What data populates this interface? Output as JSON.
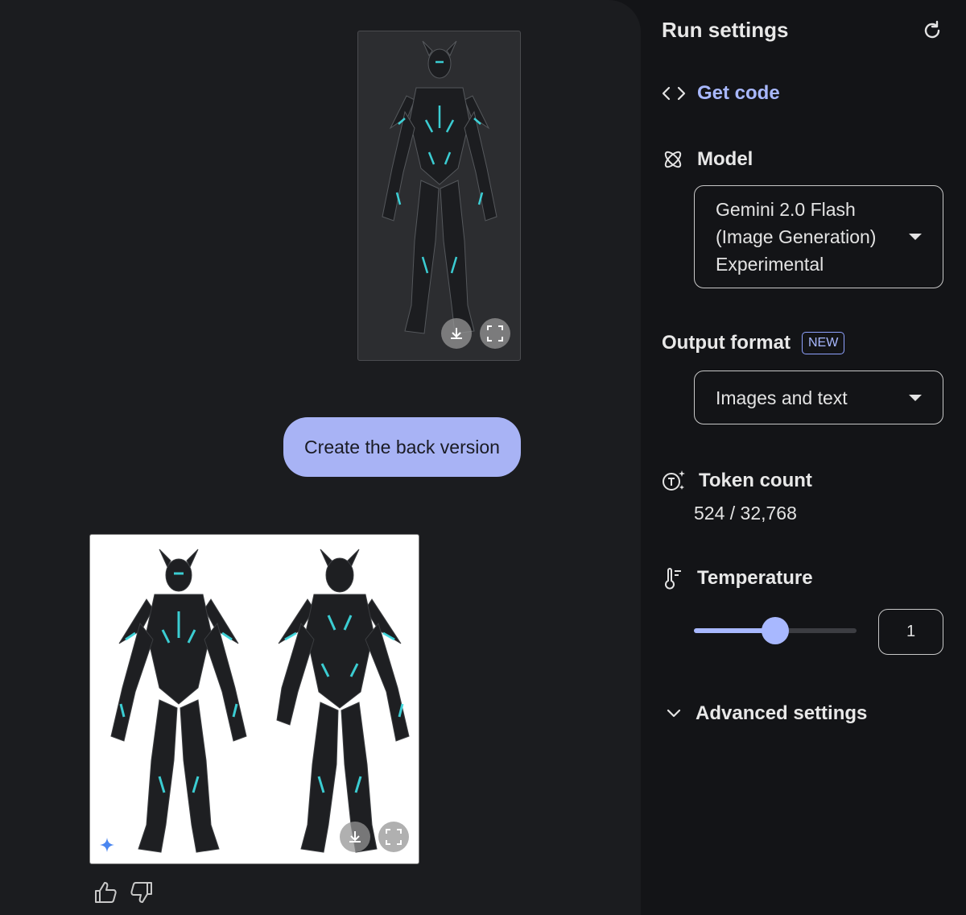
{
  "chat": {
    "user_message": "Create the back version"
  },
  "settings": {
    "title": "Run settings",
    "get_code_label": "Get code",
    "model_label": "Model",
    "model_value_lines": [
      "Gemini 2.0 Flash",
      "(Image Generation)",
      "Experimental"
    ],
    "output_format_label": "Output format",
    "output_format_badge": "NEW",
    "output_format_value": "Images and text",
    "token_count_label": "Token count",
    "token_count_value": "524 / 32,768",
    "temperature_label": "Temperature",
    "temperature_value": "1",
    "temperature_slider_fraction": 0.5,
    "advanced_label": "Advanced settings"
  },
  "colors": {
    "accent": "#a8b8ff",
    "user_bubble": "#a8b3f5",
    "armor_glow": "#3fe0e6"
  },
  "icons": [
    "download-icon",
    "fullscreen-icon",
    "sparkle-icon",
    "thumbs-up-icon",
    "thumbs-down-icon",
    "refresh-icon",
    "code-icon",
    "model-atom-icon",
    "token-icon",
    "thermometer-icon",
    "chevron-down-icon"
  ]
}
